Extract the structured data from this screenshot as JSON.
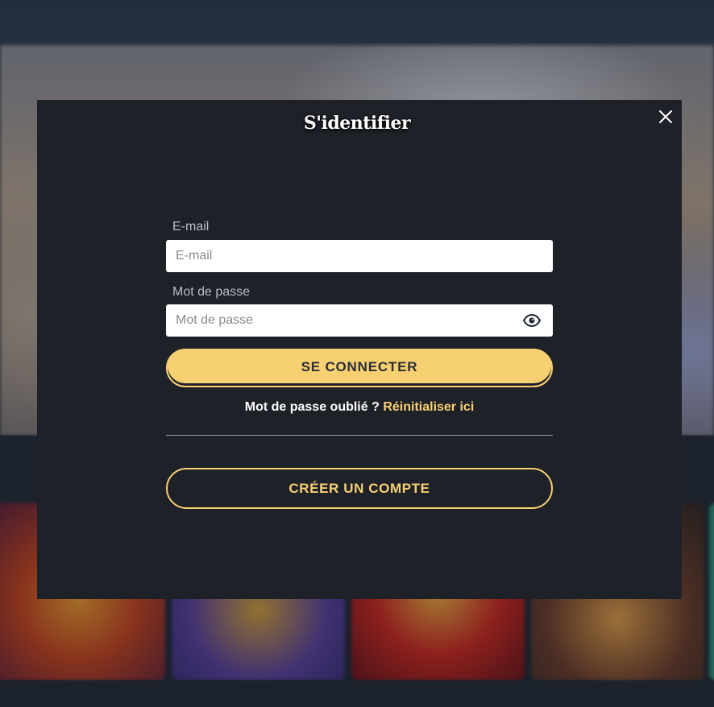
{
  "modal": {
    "title": "S'identifier",
    "close_icon": "close-icon"
  },
  "form": {
    "email": {
      "label": "E-mail",
      "placeholder": "E-mail",
      "value": ""
    },
    "password": {
      "label": "Mot de passe",
      "placeholder": "Mot de passe",
      "value": "",
      "toggle_icon": "eye-icon"
    },
    "submit_label": "SE CONNECTER",
    "forgot_text": "Mot de passe oublié ?",
    "reset_link": "Réinitialiser ici",
    "create_account_label": "CRÉER UN COMPTE"
  },
  "colors": {
    "accent": "#f7d072",
    "modal_bg": "#1f2129",
    "divider": "#8fa3c0"
  }
}
